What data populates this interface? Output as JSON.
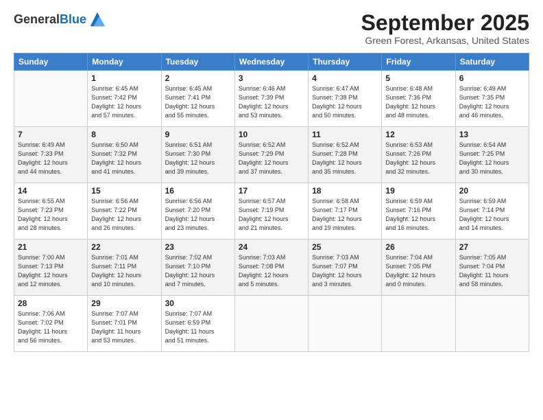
{
  "logo": {
    "general": "General",
    "blue": "Blue"
  },
  "header": {
    "month": "September 2025",
    "location": "Green Forest, Arkansas, United States"
  },
  "weekdays": [
    "Sunday",
    "Monday",
    "Tuesday",
    "Wednesday",
    "Thursday",
    "Friday",
    "Saturday"
  ],
  "weeks": [
    [
      {
        "day": null,
        "info": null
      },
      {
        "day": "1",
        "info": "Sunrise: 6:45 AM\nSunset: 7:42 PM\nDaylight: 12 hours\nand 57 minutes."
      },
      {
        "day": "2",
        "info": "Sunrise: 6:45 AM\nSunset: 7:41 PM\nDaylight: 12 hours\nand 55 minutes."
      },
      {
        "day": "3",
        "info": "Sunrise: 6:46 AM\nSunset: 7:39 PM\nDaylight: 12 hours\nand 53 minutes."
      },
      {
        "day": "4",
        "info": "Sunrise: 6:47 AM\nSunset: 7:38 PM\nDaylight: 12 hours\nand 50 minutes."
      },
      {
        "day": "5",
        "info": "Sunrise: 6:48 AM\nSunset: 7:36 PM\nDaylight: 12 hours\nand 48 minutes."
      },
      {
        "day": "6",
        "info": "Sunrise: 6:49 AM\nSunset: 7:35 PM\nDaylight: 12 hours\nand 46 minutes."
      }
    ],
    [
      {
        "day": "7",
        "info": "Sunrise: 6:49 AM\nSunset: 7:33 PM\nDaylight: 12 hours\nand 44 minutes."
      },
      {
        "day": "8",
        "info": "Sunrise: 6:50 AM\nSunset: 7:32 PM\nDaylight: 12 hours\nand 41 minutes."
      },
      {
        "day": "9",
        "info": "Sunrise: 6:51 AM\nSunset: 7:30 PM\nDaylight: 12 hours\nand 39 minutes."
      },
      {
        "day": "10",
        "info": "Sunrise: 6:52 AM\nSunset: 7:29 PM\nDaylight: 12 hours\nand 37 minutes."
      },
      {
        "day": "11",
        "info": "Sunrise: 6:52 AM\nSunset: 7:28 PM\nDaylight: 12 hours\nand 35 minutes."
      },
      {
        "day": "12",
        "info": "Sunrise: 6:53 AM\nSunset: 7:26 PM\nDaylight: 12 hours\nand 32 minutes."
      },
      {
        "day": "13",
        "info": "Sunrise: 6:54 AM\nSunset: 7:25 PM\nDaylight: 12 hours\nand 30 minutes."
      }
    ],
    [
      {
        "day": "14",
        "info": "Sunrise: 6:55 AM\nSunset: 7:23 PM\nDaylight: 12 hours\nand 28 minutes."
      },
      {
        "day": "15",
        "info": "Sunrise: 6:56 AM\nSunset: 7:22 PM\nDaylight: 12 hours\nand 26 minutes."
      },
      {
        "day": "16",
        "info": "Sunrise: 6:56 AM\nSunset: 7:20 PM\nDaylight: 12 hours\nand 23 minutes."
      },
      {
        "day": "17",
        "info": "Sunrise: 6:57 AM\nSunset: 7:19 PM\nDaylight: 12 hours\nand 21 minutes."
      },
      {
        "day": "18",
        "info": "Sunrise: 6:58 AM\nSunset: 7:17 PM\nDaylight: 12 hours\nand 19 minutes."
      },
      {
        "day": "19",
        "info": "Sunrise: 6:59 AM\nSunset: 7:16 PM\nDaylight: 12 hours\nand 16 minutes."
      },
      {
        "day": "20",
        "info": "Sunrise: 6:59 AM\nSunset: 7:14 PM\nDaylight: 12 hours\nand 14 minutes."
      }
    ],
    [
      {
        "day": "21",
        "info": "Sunrise: 7:00 AM\nSunset: 7:13 PM\nDaylight: 12 hours\nand 12 minutes."
      },
      {
        "day": "22",
        "info": "Sunrise: 7:01 AM\nSunset: 7:11 PM\nDaylight: 12 hours\nand 10 minutes."
      },
      {
        "day": "23",
        "info": "Sunrise: 7:02 AM\nSunset: 7:10 PM\nDaylight: 12 hours\nand 7 minutes."
      },
      {
        "day": "24",
        "info": "Sunrise: 7:03 AM\nSunset: 7:08 PM\nDaylight: 12 hours\nand 5 minutes."
      },
      {
        "day": "25",
        "info": "Sunrise: 7:03 AM\nSunset: 7:07 PM\nDaylight: 12 hours\nand 3 minutes."
      },
      {
        "day": "26",
        "info": "Sunrise: 7:04 AM\nSunset: 7:05 PM\nDaylight: 12 hours\nand 0 minutes."
      },
      {
        "day": "27",
        "info": "Sunrise: 7:05 AM\nSunset: 7:04 PM\nDaylight: 11 hours\nand 58 minutes."
      }
    ],
    [
      {
        "day": "28",
        "info": "Sunrise: 7:06 AM\nSunset: 7:02 PM\nDaylight: 11 hours\nand 56 minutes."
      },
      {
        "day": "29",
        "info": "Sunrise: 7:07 AM\nSunset: 7:01 PM\nDaylight: 11 hours\nand 53 minutes."
      },
      {
        "day": "30",
        "info": "Sunrise: 7:07 AM\nSunset: 6:59 PM\nDaylight: 11 hours\nand 51 minutes."
      },
      {
        "day": null,
        "info": null
      },
      {
        "day": null,
        "info": null
      },
      {
        "day": null,
        "info": null
      },
      {
        "day": null,
        "info": null
      }
    ]
  ]
}
